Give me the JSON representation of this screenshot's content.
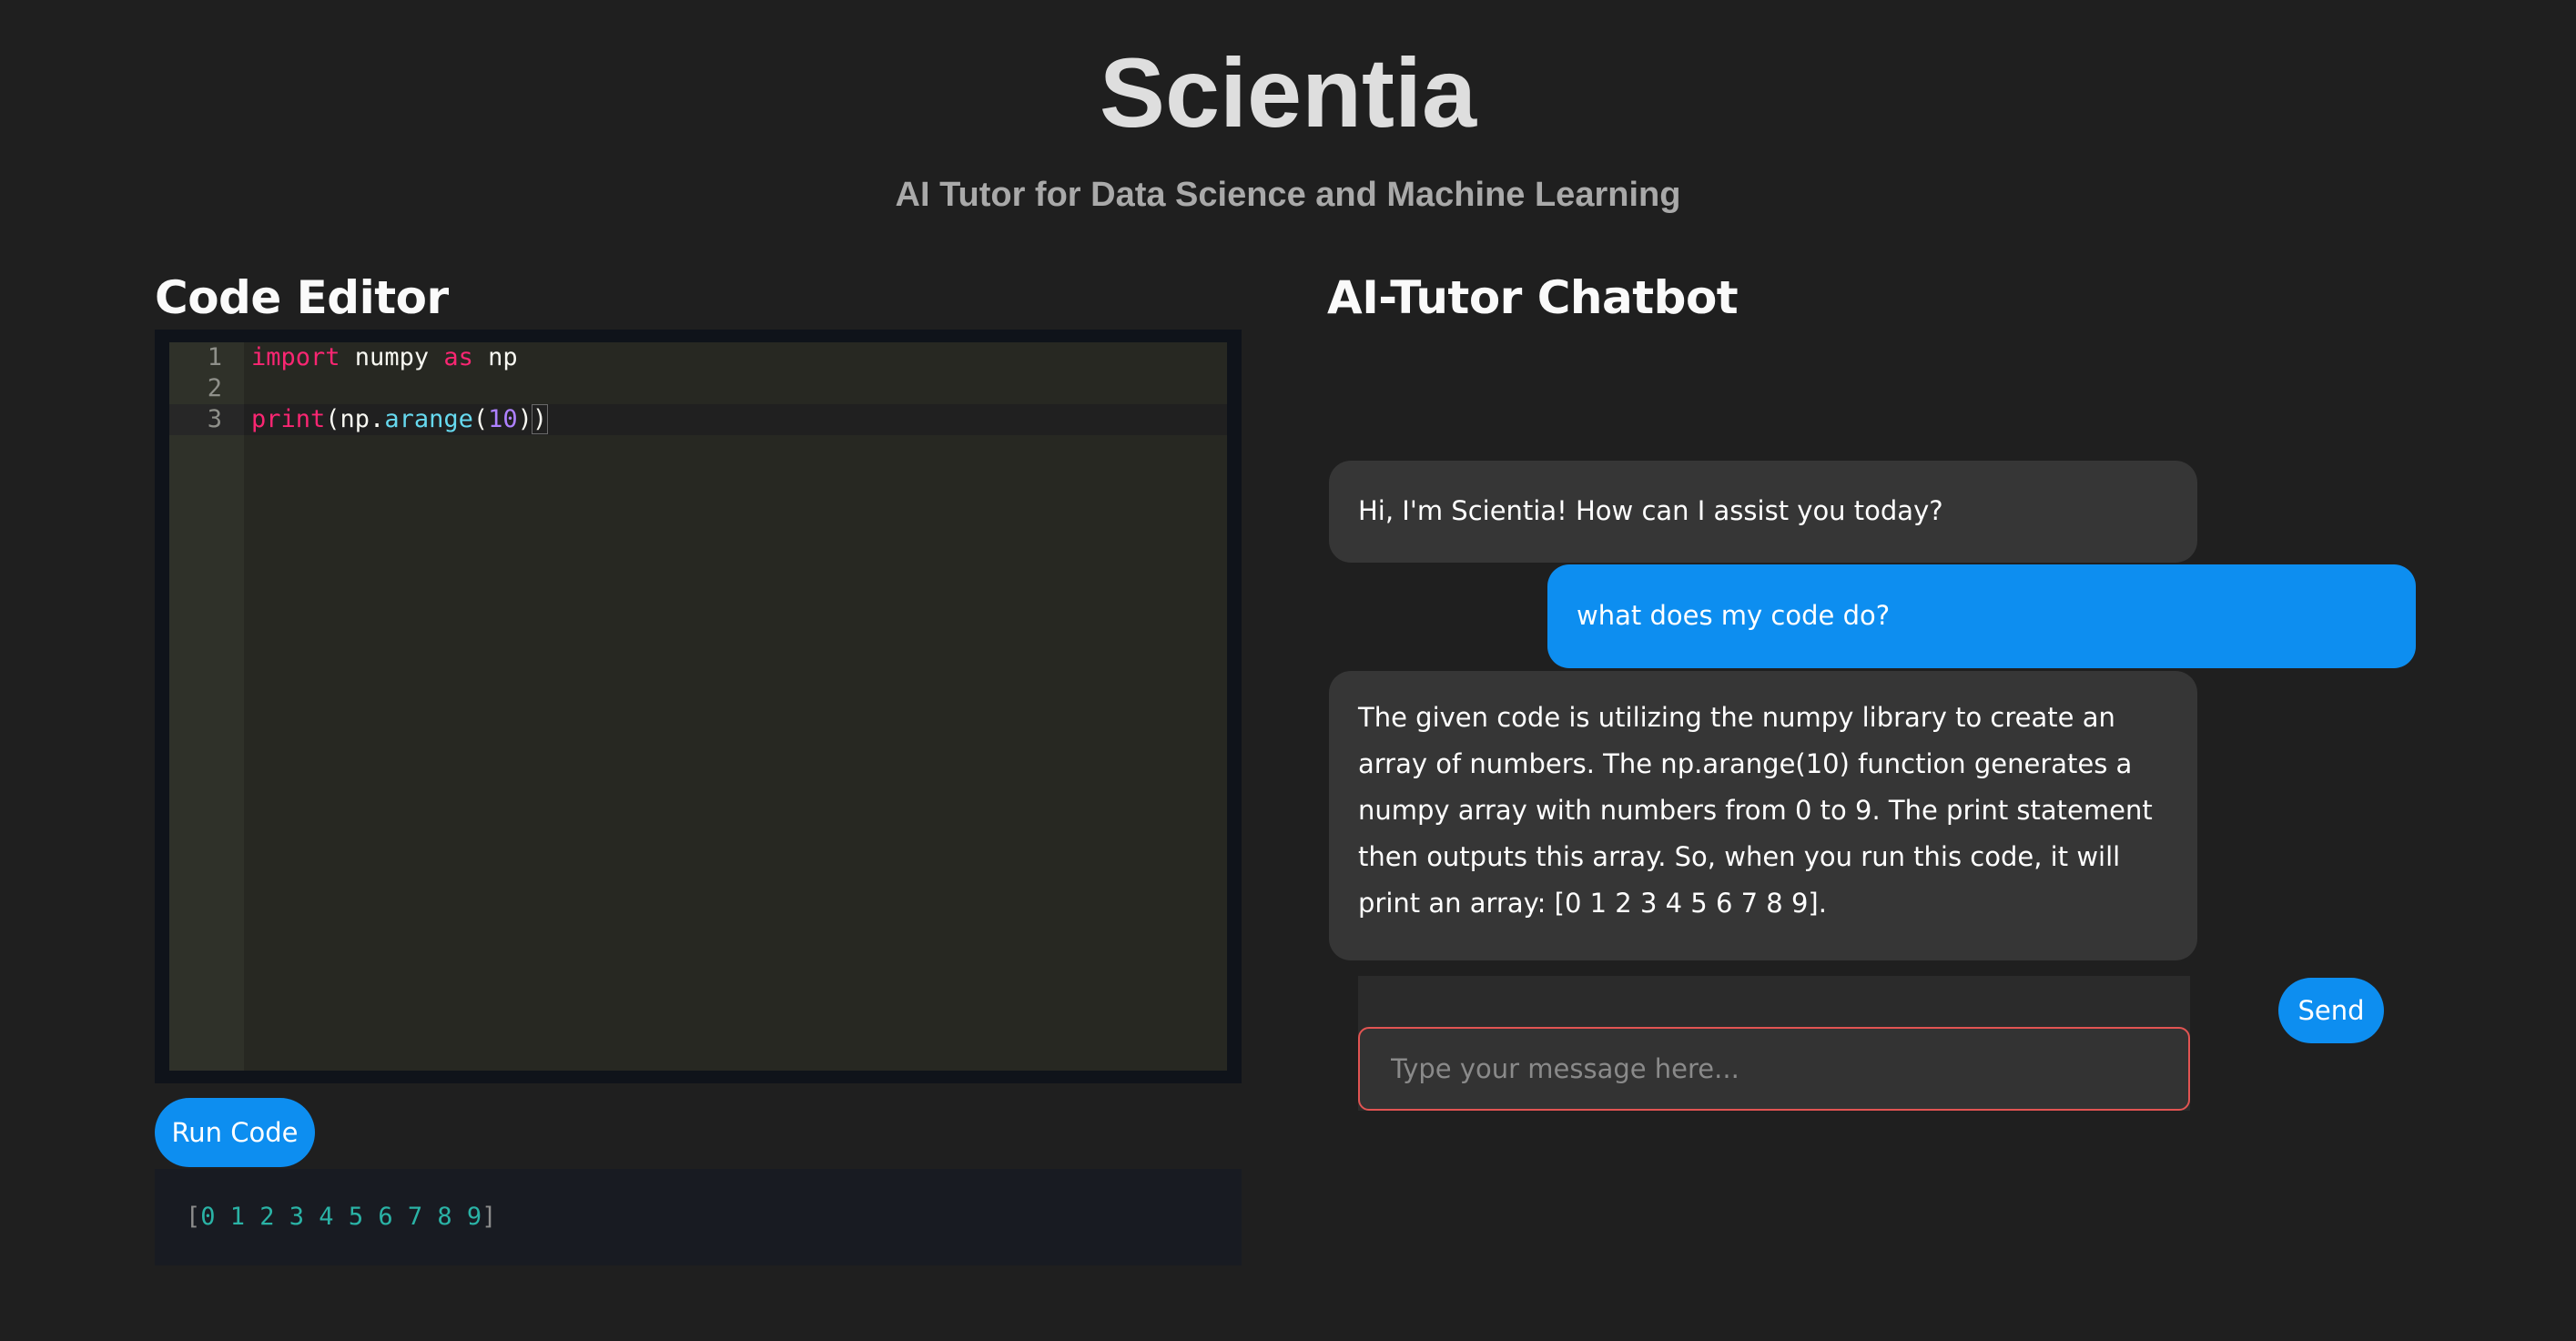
{
  "header": {
    "title": "Scientia",
    "subtitle": "AI Tutor for Data Science and Machine Learning"
  },
  "editor": {
    "heading": "Code Editor",
    "lines": [
      {
        "number": "1",
        "tokens": [
          "import",
          " numpy ",
          "as",
          " np"
        ]
      },
      {
        "number": "2",
        "tokens": []
      },
      {
        "number": "3",
        "tokens": [
          "print",
          "(",
          "np.",
          "arange",
          "(",
          "10",
          ")",
          ")"
        ]
      }
    ],
    "run_label": "Run Code",
    "output_open": "[",
    "output_values": "0 1 2 3 4 5 6 7 8 9",
    "output_close": "]"
  },
  "chat": {
    "heading": "AI-Tutor Chatbot",
    "messages": [
      {
        "role": "assistant",
        "text": "Hi, I'm Scientia! How can I assist you today?"
      },
      {
        "role": "user",
        "text": "what does my code do?"
      },
      {
        "role": "assistant",
        "text": "The given code is utilizing the numpy library to create an array of numbers. The np.arange(10) function generates a numpy array with numbers from 0 to 9. The print statement then outputs this array. So, when you run this code, it will print an array: [0 1 2 3 4 5 6 7 8 9]."
      }
    ],
    "input_value": "",
    "input_placeholder": "Type your message here...",
    "send_label": "Send"
  },
  "colors": {
    "background": "#1f1f1f",
    "accent": "#0d8ef0",
    "bot_bubble": "#363636",
    "input_border": "#e25452",
    "editor_bg": "#272822"
  }
}
